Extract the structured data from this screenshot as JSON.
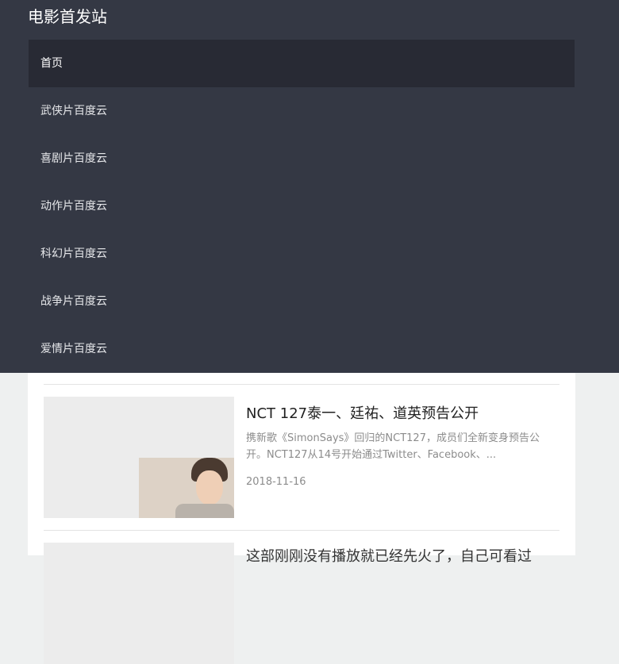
{
  "site": {
    "title": "电影首发站"
  },
  "menu": {
    "items": [
      {
        "label": "首页"
      },
      {
        "label": "武侠片百度云"
      },
      {
        "label": "喜剧片百度云"
      },
      {
        "label": "动作片百度云"
      },
      {
        "label": "科幻片百度云"
      },
      {
        "label": "战争片百度云"
      },
      {
        "label": "爱情片百度云"
      }
    ]
  },
  "articles": [
    {
      "title": "NCT 127泰一、廷祐、道英预告公开",
      "excerpt": "携新歌《SimonSays》回归的NCT127，成员们全新变身预告公开。NCT127从14号开始通过Twitter、Facebook、...",
      "date": "2018-11-16"
    },
    {
      "title": "这部刚刚没有播放就已经先火了，自己可看过"
    }
  ]
}
